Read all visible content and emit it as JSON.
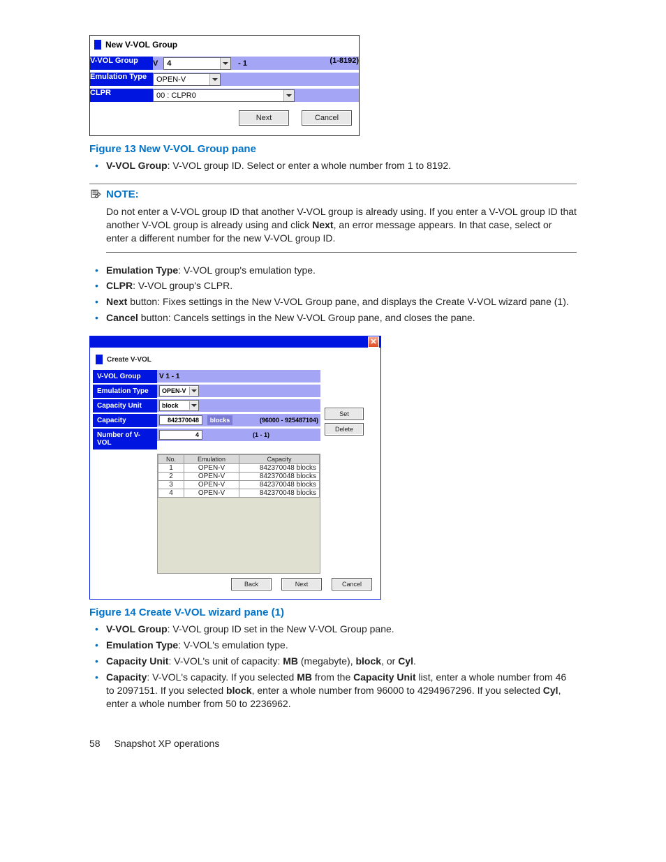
{
  "figure13": {
    "pane_title": "New V-VOL Group",
    "rows": {
      "vvol_group": {
        "label": "V-VOL Group",
        "prefix": "V",
        "input_value": "4",
        "suffix": "- 1",
        "range_hint": "(1-8192)"
      },
      "emulation": {
        "label": "Emulation Type",
        "value": "OPEN-V"
      },
      "clpr": {
        "label": "CLPR",
        "value": "00 : CLPR0"
      }
    },
    "buttons": {
      "next": "Next",
      "cancel": "Cancel"
    },
    "caption": "Figure 13 New V-VOL Group pane"
  },
  "after13": {
    "vvol_group": {
      "term": "V-VOL Group",
      "text": ": V-VOL group ID. Select or enter a whole number from 1 to 8192."
    }
  },
  "note": {
    "heading": "NOTE:",
    "body_pre": "Do not enter a V-VOL group ID that another V-VOL group is already using. If you enter a V-VOL group ID that another V-VOL group is already using and click ",
    "body_bold": "Next",
    "body_post": ", an error message appears. In that case, select or enter a different number for the new V-VOL group ID."
  },
  "bullets13b": {
    "emulation": {
      "term": "Emulation Type",
      "text": ": V-VOL group's emulation type."
    },
    "clpr": {
      "term": "CLPR",
      "text": ": V-VOL group's CLPR."
    },
    "next": {
      "term": "Next",
      "text": " button: Fixes settings in the New V-VOL Group pane, and displays the Create V-VOL wizard pane (1)."
    },
    "cancel": {
      "term": "Cancel",
      "text": " button: Cancels settings in the New V-VOL Group pane, and closes the pane."
    }
  },
  "figure14": {
    "pane_title": "Create V-VOL",
    "rows": {
      "vvol_group": {
        "label": "V-VOL Group",
        "value": "V 1 - 1"
      },
      "emulation": {
        "label": "Emulation Type",
        "value": "OPEN-V"
      },
      "capacity_unit": {
        "label": "Capacity Unit",
        "value": "block"
      },
      "capacity": {
        "label": "Capacity",
        "value": "842370048",
        "unit_label": "blocks",
        "range": "(96000 - 925487104)"
      },
      "num_vvol": {
        "label": "Number of V-VOL",
        "value": "4",
        "range": "(1 - 1)"
      }
    },
    "side_buttons": {
      "set": "Set",
      "delete": "Delete"
    },
    "grid": {
      "headers": {
        "no": "No.",
        "emulation": "Emulation",
        "capacity": "Capacity"
      },
      "rows": [
        {
          "no": "1",
          "emu": "OPEN-V",
          "cap": "842370048 blocks"
        },
        {
          "no": "2",
          "emu": "OPEN-V",
          "cap": "842370048 blocks"
        },
        {
          "no": "3",
          "emu": "OPEN-V",
          "cap": "842370048 blocks"
        },
        {
          "no": "4",
          "emu": "OPEN-V",
          "cap": "842370048 blocks"
        }
      ]
    },
    "buttons": {
      "back": "Back",
      "next": "Next",
      "cancel": "Cancel"
    },
    "caption": "Figure 14 Create V-VOL wizard pane (1)"
  },
  "bullets14": {
    "vvol_group": {
      "term": "V-VOL Group",
      "text": ": V-VOL group ID set in the New V-VOL Group pane."
    },
    "emulation": {
      "term": "Emulation Type",
      "text": ": V-VOL's emulation type."
    },
    "capacity_unit": {
      "term": "Capacity Unit",
      "text_a": ": V-VOL's unit of capacity: ",
      "b1": "MB",
      "text_b": " (megabyte), ",
      "b2": "block",
      "text_c": ", or ",
      "b3": "Cyl",
      "text_d": "."
    },
    "capacity": {
      "term": "Capacity",
      "t1": ": V-VOL's capacity. If you selected ",
      "b1": "MB",
      "t2": " from the ",
      "b2": "Capacity Unit",
      "t3": " list, enter a whole number from 46 to 2097151. If you selected ",
      "b3": "block",
      "t4": ", enter a whole number from 96000 to 4294967296. If you selected ",
      "b4": "Cyl",
      "t5": ", enter a whole number from 50 to 2236962."
    }
  },
  "footer": {
    "page": "58",
    "section": "Snapshot XP operations"
  }
}
